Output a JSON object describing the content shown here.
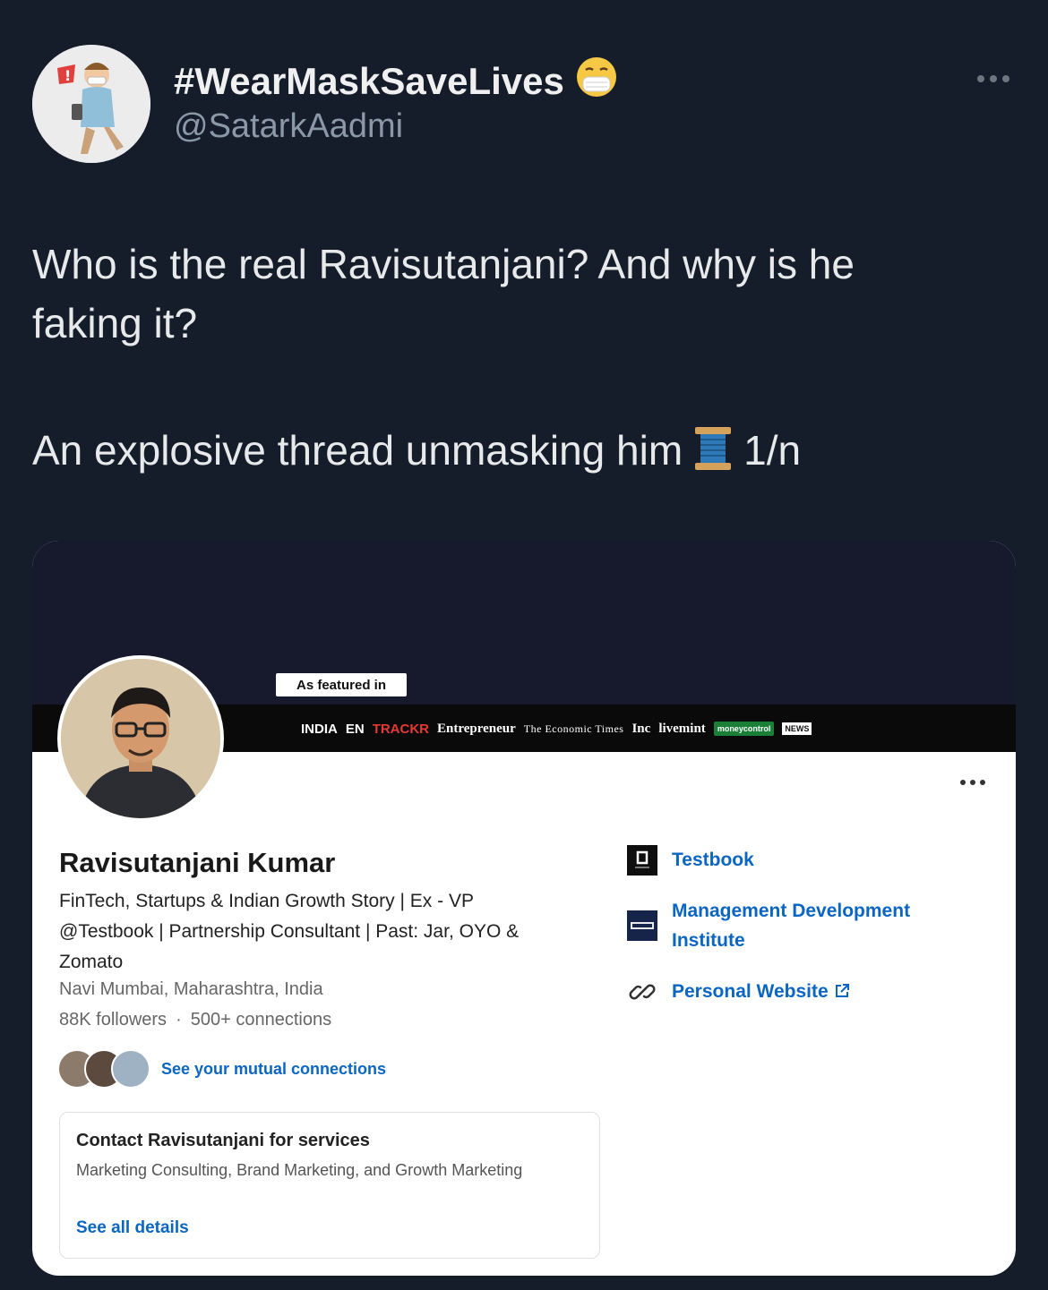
{
  "tweet": {
    "display_name": "#WearMaskSaveLives",
    "handle": "@SatarkAadmi",
    "text_line1": "Who is the real Ravisutanjani? And why is he faking it?",
    "text_line2_main": "An explosive thread unmasking him",
    "text_line2_counter": "1/n",
    "name_emoji_icon": "mask-face-icon",
    "thread_emoji_icon": "spool-of-thread-icon"
  },
  "linkedin": {
    "featured_label": "As featured in",
    "media_logos": [
      "INDIA",
      "EN",
      "TRACKR",
      "Entrepreneur",
      "The Economic Times",
      "Inc",
      "livemint",
      "moneycontrol",
      "NEWS"
    ],
    "name": "Ravisutanjani Kumar",
    "headline": "FinTech, Startups & Indian Growth Story | Ex - VP @Testbook | Partnership Consultant | Past: Jar, OYO & Zomato",
    "location": "Navi Mumbai, Maharashtra, India",
    "followers": "88K followers",
    "connections": "500+ connections",
    "mutual_link": "See your mutual connections",
    "services": {
      "title": "Contact Ravisutanjani for services",
      "list": "Marketing Consulting, Brand Marketing, and Growth Marketing",
      "link": "See all details"
    },
    "right_column": [
      {
        "label": "Testbook",
        "icon": "testbook-logo-icon"
      },
      {
        "label": "Management Development Institute",
        "icon": "mdi-logo-icon"
      },
      {
        "label": "Personal Website",
        "icon": "link-icon"
      }
    ],
    "colors": {
      "link_blue": "#0a66c2",
      "cover": "#161a2c"
    }
  }
}
